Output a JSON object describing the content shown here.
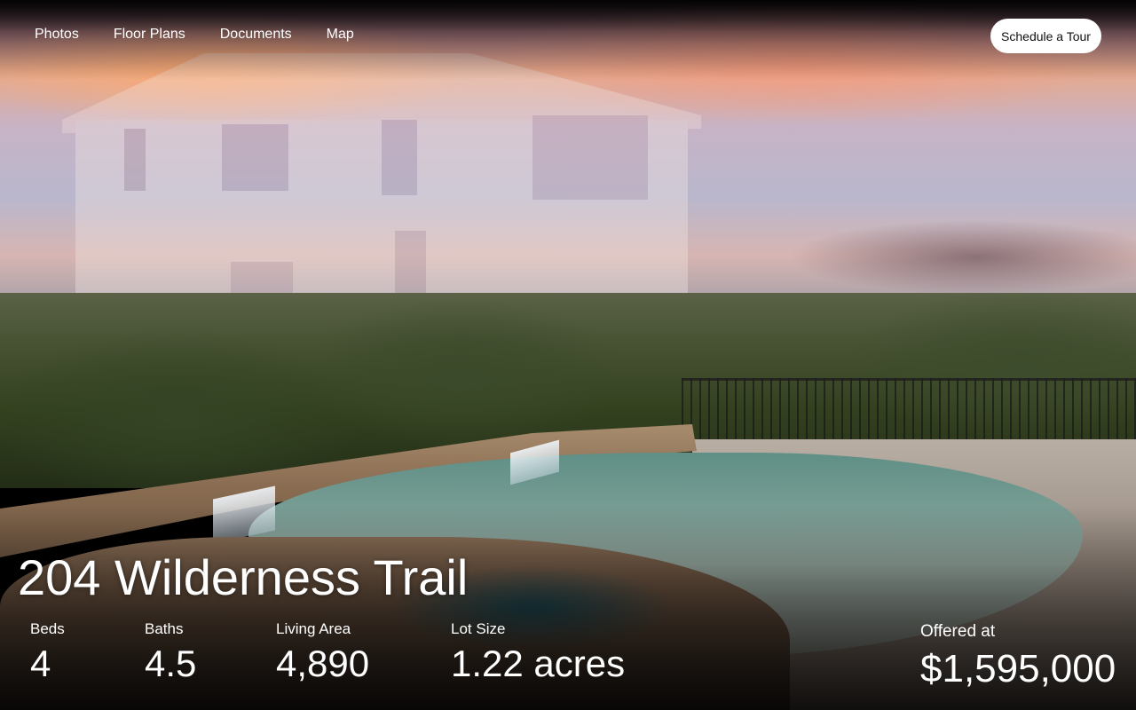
{
  "nav": {
    "links": [
      {
        "label": "Photos"
      },
      {
        "label": "Floor Plans"
      },
      {
        "label": "Documents"
      },
      {
        "label": "Map"
      }
    ],
    "cta_label": "Schedule a Tour"
  },
  "listing": {
    "address": "204 Wilderness Trail",
    "stats": [
      {
        "label": "Beds",
        "value": "4"
      },
      {
        "label": "Baths",
        "value": "4.5"
      },
      {
        "label": "Living Area",
        "value": "4,890"
      },
      {
        "label": "Lot Size",
        "value": "1.22 acres"
      }
    ],
    "price_label": "Offered at",
    "price": "$1,595,000"
  },
  "hero_image": {
    "subject": "house-reflection-sunset-pool-hill-country-photo"
  },
  "colors": {
    "text": "#ffffff",
    "cta_background": "#ffffff",
    "cta_text": "#111111"
  }
}
